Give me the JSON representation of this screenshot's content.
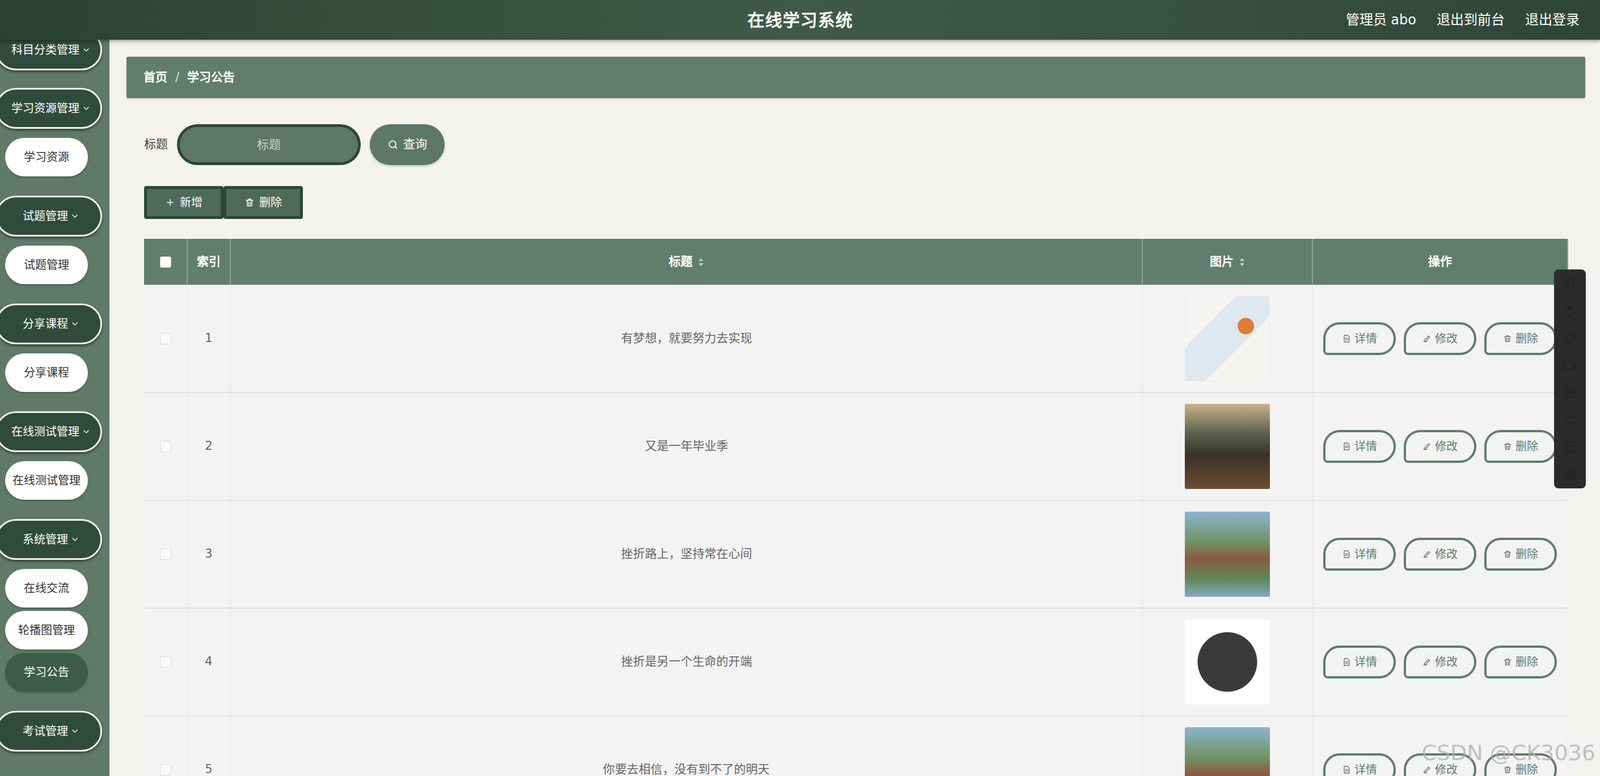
{
  "header": {
    "title": "在线学习系统",
    "user": "管理员 abo",
    "links": [
      "退出到前台",
      "退出登录"
    ]
  },
  "sidebar": {
    "items": [
      {
        "label": "科目分类管理",
        "kind": "group",
        "selected": false
      },
      {
        "label": "学习资源管理",
        "kind": "group",
        "selected": false
      },
      {
        "label": "学习资源",
        "kind": "link",
        "selected": false
      },
      {
        "label": "试题管理",
        "kind": "group",
        "selected": false
      },
      {
        "label": "试题管理",
        "kind": "link",
        "selected": false
      },
      {
        "label": "分享课程",
        "kind": "group",
        "selected": false
      },
      {
        "label": "分享课程",
        "kind": "link",
        "selected": false
      },
      {
        "label": "在线测试管理",
        "kind": "group",
        "selected": false
      },
      {
        "label": "在线测试管理",
        "kind": "link",
        "selected": false
      },
      {
        "label": "系统管理",
        "kind": "group",
        "selected": false
      },
      {
        "label": "在线交流",
        "kind": "link",
        "selected": false
      },
      {
        "label": "轮播图管理",
        "kind": "link",
        "selected": false
      },
      {
        "label": "学习公告",
        "kind": "link",
        "selected": true
      },
      {
        "label": "考试管理",
        "kind": "group",
        "selected": false
      }
    ]
  },
  "breadcrumb": {
    "items": [
      "首页",
      "学习公告"
    ],
    "separator": "/"
  },
  "search": {
    "label": "标题",
    "placeholder": "标题",
    "button": "查询"
  },
  "actions": [
    "新增",
    "删除"
  ],
  "table": {
    "select_all": false,
    "columns": [
      {
        "label": "索引",
        "sortable": false
      },
      {
        "label": "标题",
        "sortable": true
      },
      {
        "label": "图片",
        "sortable": true
      },
      {
        "label": "操作",
        "sortable": false
      }
    ],
    "rows": [
      {
        "checked": false,
        "index": "1",
        "title": "有梦想，就要努力去实现",
        "image_kind": "news-illustration",
        "actions": [
          "详情",
          "修改",
          "删除"
        ]
      },
      {
        "checked": false,
        "index": "2",
        "title": "又是一年毕业季",
        "image_kind": "classroom-photo",
        "actions": [
          "详情",
          "修改",
          "删除"
        ]
      },
      {
        "checked": false,
        "index": "3",
        "title": "挫折路上，坚持常在心间",
        "image_kind": "campus-photo",
        "actions": [
          "详情",
          "修改",
          "删除"
        ]
      },
      {
        "checked": false,
        "index": "4",
        "title": "挫折是另一个生命的开端",
        "image_kind": "news-badge",
        "actions": [
          "详情",
          "修改",
          "删除"
        ]
      },
      {
        "checked": false,
        "index": "5",
        "title": "你要去相信，没有到不了的明天",
        "image_kind": "campus-photo",
        "actions": [
          "详情",
          "修改",
          "删除"
        ]
      }
    ]
  },
  "watermark": "CSDN @CK3036"
}
